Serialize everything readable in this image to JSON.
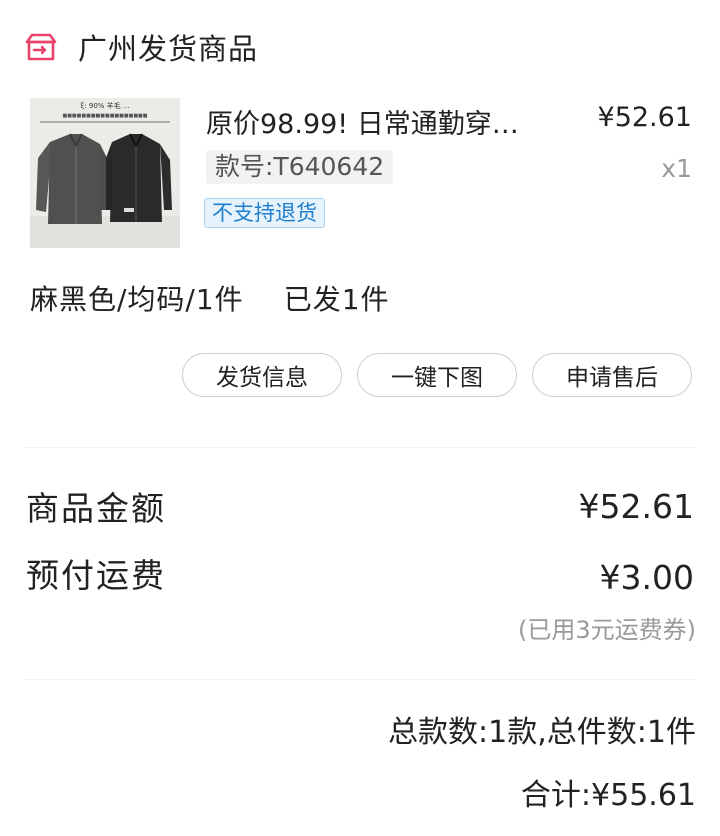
{
  "header": {
    "shop_name": "广州发货商品",
    "icon": "shipping-box-icon",
    "accent": "#e8436a"
  },
  "product": {
    "thumbnail_caption": "ξ: 90% 羊毛 ...",
    "title": "原价98.99! 日常通勤穿…",
    "price": "¥52.61",
    "sku": "款号:T640642",
    "qty": "x1",
    "badge": "不支持退货"
  },
  "spec": {
    "variant": "麻黑色/均码/1件",
    "status": "已发1件"
  },
  "actions": {
    "ship_info": "发货信息",
    "download_images": "一键下图",
    "after_sale": "申请售后"
  },
  "summary": {
    "goods_amount_label": "商品金额",
    "goods_amount_value": "¥52.61",
    "shipping_label": "预付运费",
    "shipping_value": "¥3.00",
    "coupon_note": "(已用3元运费券)"
  },
  "totals": {
    "count_text": "总款数:1款,总件数:1件",
    "grand_total": "合计:¥55.61"
  }
}
